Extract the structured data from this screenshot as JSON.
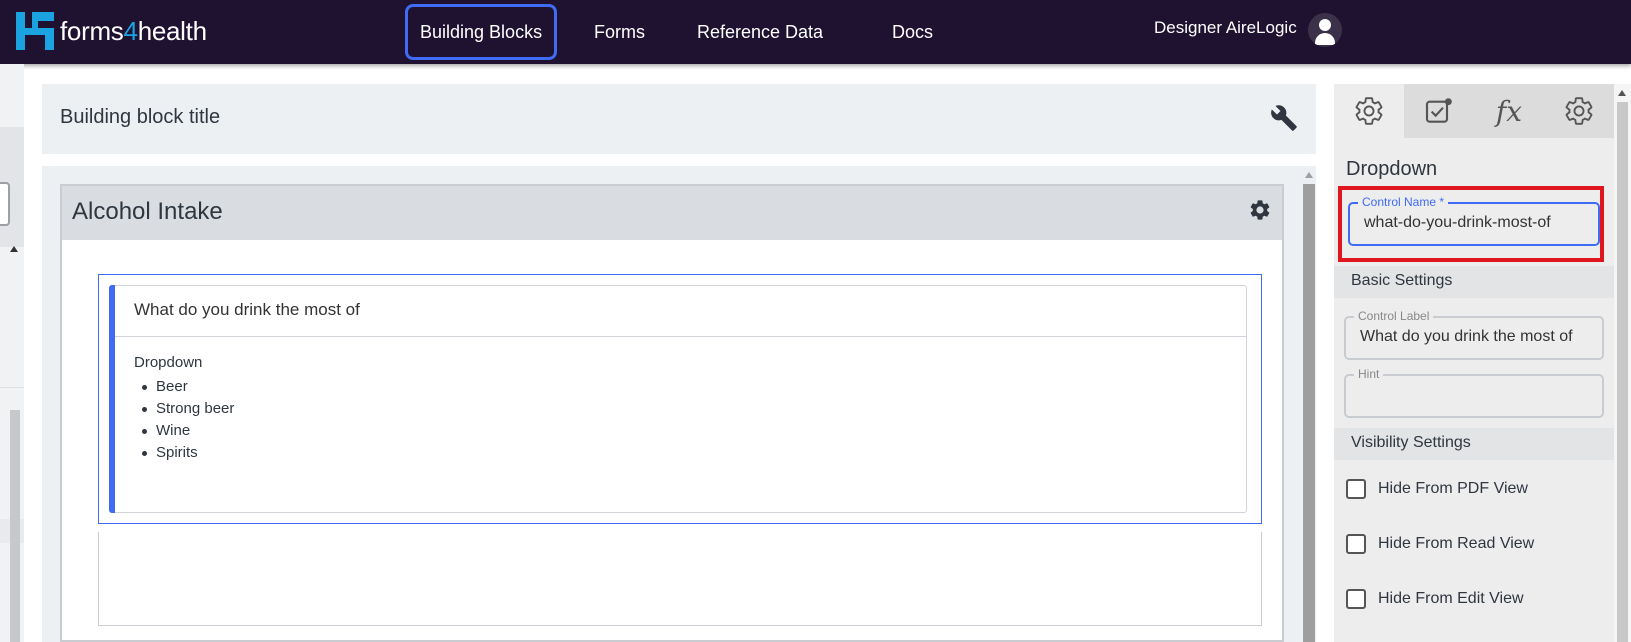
{
  "app": {
    "logo_text_a": "forms",
    "logo_text_num": "4",
    "logo_text_b": "health"
  },
  "nav": {
    "items": [
      {
        "label": "Building Blocks",
        "active": true
      },
      {
        "label": "Forms",
        "active": false
      },
      {
        "label": "Reference Data",
        "active": false
      },
      {
        "label": "Docs",
        "active": false
      }
    ],
    "user_name": "Designer AireLogic"
  },
  "building_block": {
    "title": "Building block title"
  },
  "section": {
    "title": "Alcohol Intake",
    "control": {
      "label": "What do you drink the most of",
      "type": "Dropdown",
      "options": [
        "Beer",
        "Strong beer",
        "Wine",
        "Spirits"
      ]
    }
  },
  "properties": {
    "tabs": [
      "general-settings",
      "validation",
      "fx",
      "advanced-settings"
    ],
    "fx_label": "fx",
    "heading": "Dropdown",
    "control_name_label": "Control Name *",
    "control_name_value": "what-do-you-drink-most-of",
    "basic_settings_label": "Basic Settings",
    "control_label_label": "Control Label",
    "control_label_value": "What do you drink the most of",
    "hint_label": "Hint",
    "hint_value": "",
    "visibility_settings_label": "Visibility Settings",
    "visibility": [
      {
        "label": "Hide From PDF View",
        "checked": false
      },
      {
        "label": "Hide From Read View",
        "checked": false
      },
      {
        "label": "Hide From Edit View",
        "checked": false
      }
    ]
  },
  "colors": {
    "topbar": "#1f1230",
    "accent": "#3f6bf5",
    "highlight": "#e0161f",
    "brand": "#1aa3e0"
  }
}
